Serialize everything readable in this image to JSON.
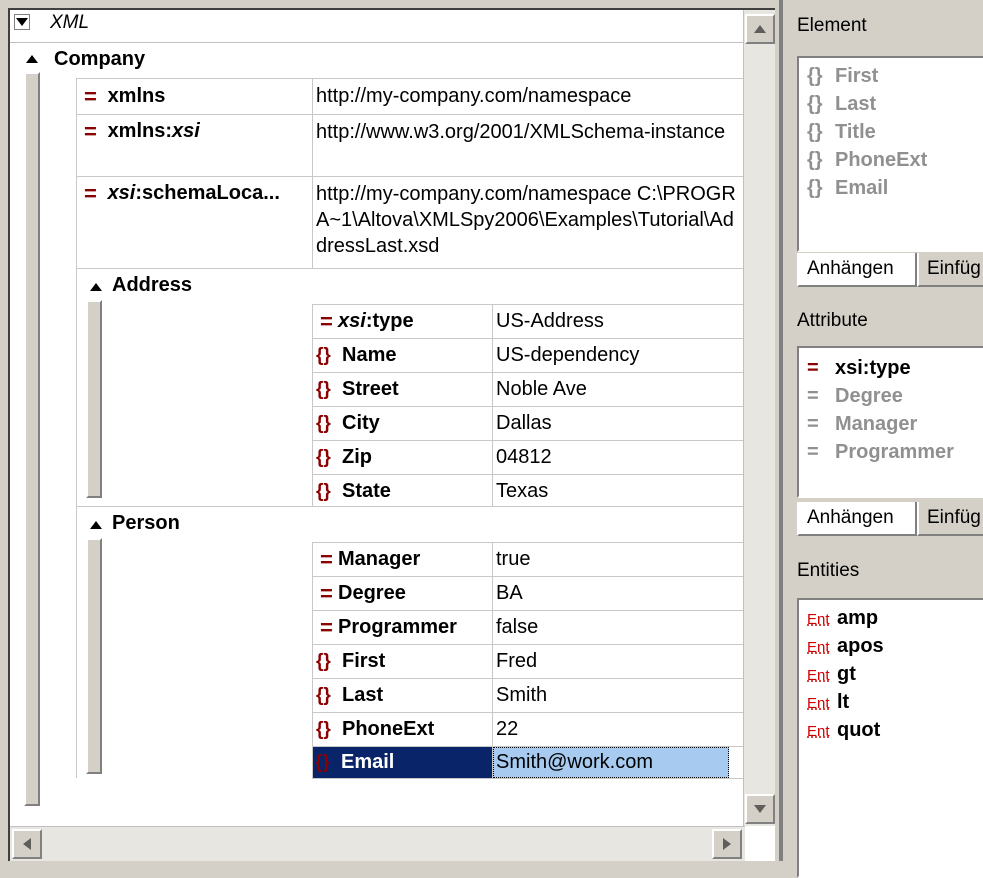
{
  "grid": {
    "root_label": "XML",
    "company": {
      "label": "Company",
      "attributes": [
        {
          "prefix": "",
          "name": "xmlns",
          "value": "http://my-company.com/namespace"
        },
        {
          "prefix": "xmlns:",
          "name": "xsi",
          "value": "http://www.w3.org/2001/XMLSchema-instance"
        },
        {
          "prefix": "xsi",
          "name": ":schemaLoca...",
          "value": "http://my-company.com/namespace C:\\PROGRA~1\\Altova\\XMLSpy2006\\Examples\\Tutorial\\AddressLast.xsd"
        }
      ]
    },
    "address": {
      "label": "Address",
      "rows": [
        {
          "kind": "attr",
          "prefix": "xsi",
          "name": ":type",
          "value": "US-Address"
        },
        {
          "kind": "elem",
          "name": "Name",
          "value": "US-dependency"
        },
        {
          "kind": "elem",
          "name": "Street",
          "value": "Noble Ave"
        },
        {
          "kind": "elem",
          "name": "City",
          "value": "Dallas"
        },
        {
          "kind": "elem",
          "name": "Zip",
          "value": "04812"
        },
        {
          "kind": "elem",
          "name": "State",
          "value": "Texas"
        }
      ]
    },
    "person": {
      "label": "Person",
      "rows": [
        {
          "kind": "attr",
          "name": "Manager",
          "value": "true"
        },
        {
          "kind": "attr",
          "name": "Degree",
          "value": "BA"
        },
        {
          "kind": "attr",
          "name": "Programmer",
          "value": "false"
        },
        {
          "kind": "elem",
          "name": "First",
          "value": "Fred"
        },
        {
          "kind": "elem",
          "name": "Last",
          "value": "Smith"
        },
        {
          "kind": "elem",
          "name": "PhoneExt",
          "value": "22"
        },
        {
          "kind": "elem",
          "name": "Email",
          "value": "Smith@work.com",
          "selected": true
        }
      ]
    }
  },
  "helpers": {
    "element": {
      "title": "Element",
      "items": [
        "First",
        "Last",
        "Title",
        "PhoneExt",
        "Email"
      ],
      "tabs": [
        "Anhängen",
        "Einfüg"
      ]
    },
    "attribute": {
      "title": "Attribute",
      "items": [
        {
          "name": "xsi:type",
          "enabled": true
        },
        {
          "name": "Degree",
          "enabled": false
        },
        {
          "name": "Manager",
          "enabled": false
        },
        {
          "name": "Programmer",
          "enabled": false
        }
      ],
      "tabs": [
        "Anhängen",
        "Einfüg"
      ]
    },
    "entities": {
      "title": "Entities",
      "icon_label": "Ent",
      "items": [
        "amp",
        "apos",
        "gt",
        "lt",
        "quot"
      ]
    }
  },
  "colors": {
    "selection_bg": "#0a246a",
    "selection_value_bg": "#a6caf0",
    "icon_red": "#8b0000",
    "entity_red": "#d00000"
  }
}
